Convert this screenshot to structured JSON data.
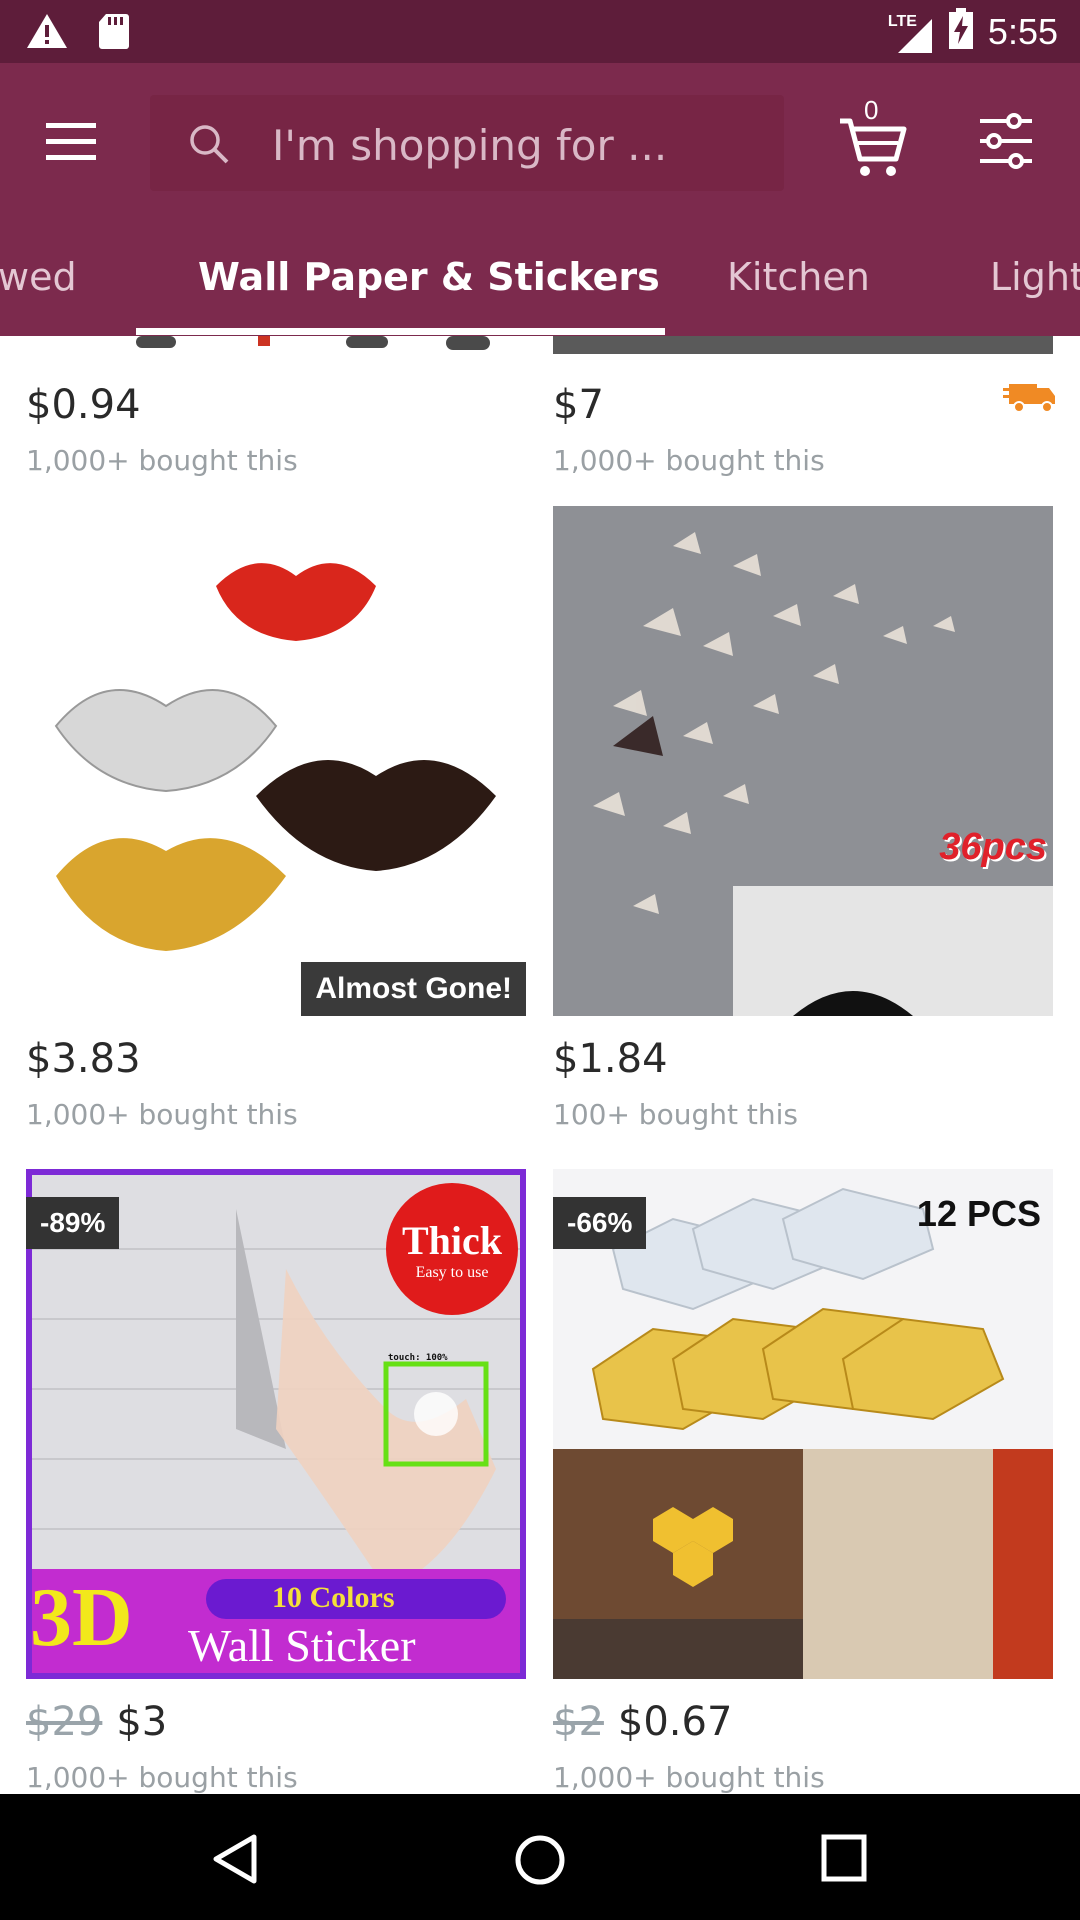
{
  "status_bar": {
    "time": "5:55",
    "network": "LTE"
  },
  "header": {
    "search_placeholder": "I'm shopping for ...",
    "cart_count": "0"
  },
  "tabs": [
    {
      "label": "wed"
    },
    {
      "label": "Wall Paper & Stickers"
    },
    {
      "label": "Kitchen"
    },
    {
      "label": "Light"
    }
  ],
  "products": [
    {
      "price": "$0.94",
      "bought": "1,000+ bought this"
    },
    {
      "price": "$7",
      "bought": "1,000+ bought this"
    },
    {
      "price": "$3.83",
      "bought": "1,000+ bought this",
      "badge": "Almost Gone!"
    },
    {
      "price": "$1.84",
      "bought": "100+ bought this",
      "image_text": "36pcs"
    },
    {
      "old_price": "$29",
      "price": "$3",
      "bought": "1,000+ bought this",
      "discount": "-89%",
      "image_text": {
        "thick": "Thick",
        "easy": "Easy to use",
        "colors": "10 Colors",
        "d3": "3D",
        "sticker": "Wall Sticker",
        "touch": "touch: 100%"
      }
    },
    {
      "old_price": "$2",
      "price": "$0.67",
      "bought": "1,000+ bought this",
      "discount": "-66%",
      "image_text": "12 PCS"
    }
  ],
  "colors": {
    "status_bar": "#5e1d3a",
    "header": "#7c2a4d",
    "shipping_icon": "#f08a24"
  }
}
